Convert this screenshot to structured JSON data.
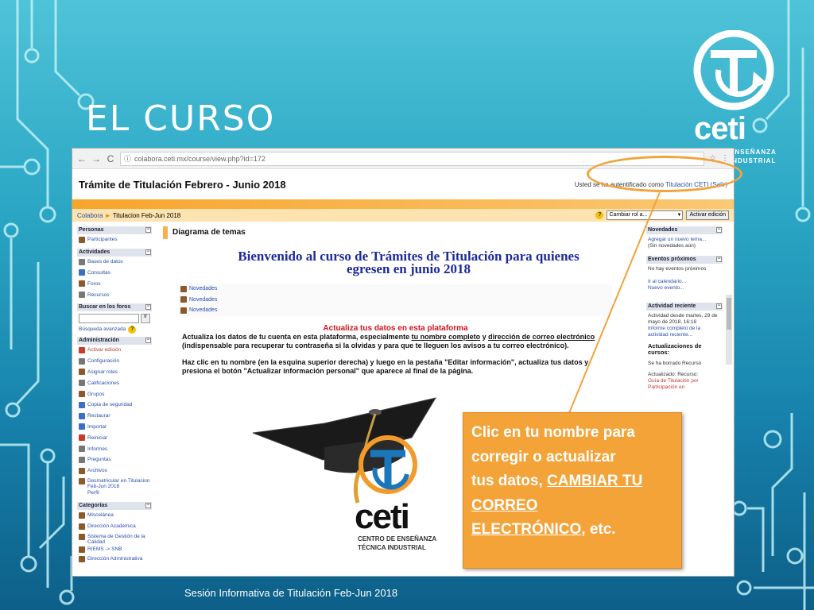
{
  "slide": {
    "title": "EL CURSO",
    "footer": "Sesión Informativa de Titulación Feb-Jun 2018",
    "logo": {
      "word": "ceti",
      "sub_line1": "ENSEÑANZA",
      "sub_line2": "INDUSTRIAL"
    }
  },
  "browser": {
    "url": "colabora.ceti.mx/course/view.php?id=172",
    "back_icon": "←",
    "forward_icon": "→",
    "reload_icon": "C",
    "info_icon": "ⓘ",
    "star_icon": "☆",
    "menu_icon": "⋮"
  },
  "page": {
    "course_title": "Trámite de Titulación Febrero - Junio 2018",
    "login_prefix": "Usted se ha autentificado como",
    "login_user": "Titulación CETI",
    "login_logout": "(Salir)",
    "breadcrumb_home": "Colabora",
    "breadcrumb_arrow": "►",
    "breadcrumb_course": "Titulacion Feb-Jun 2018",
    "help_label": "?",
    "role_select": "Cambiar rol a...",
    "edit_button": "Activar edición"
  },
  "left_blocks": {
    "personas": {
      "title": "Personas",
      "items": [
        "Participantes"
      ]
    },
    "actividades": {
      "title": "Actividades",
      "items": [
        "Bases de datos",
        "Consultas",
        "Foros",
        "Recursos"
      ]
    },
    "buscar": {
      "title": "Buscar en los foros",
      "button": "Ir",
      "advanced": "Búsqueda avanzada",
      "help": "?"
    },
    "administracion": {
      "title": "Administración",
      "items": [
        "Activar edición",
        "Configuración",
        "Asignar roles",
        "Calificaciones",
        "Grupos",
        "Copia de seguridad",
        "Restaurar",
        "Importar",
        "Reiniciar",
        "Informes",
        "Preguntas",
        "Archivos",
        "Desmatricular en Titulacion Feb-Jun 2018",
        "Perfil"
      ]
    },
    "categorias": {
      "title": "Categorías",
      "items": [
        "Miscelánea",
        "Dirección Académica",
        "Sistema de Gestión de la Calidad",
        "RIEMS -> SNB",
        "Dirección Administrativa"
      ]
    },
    "collapse_icon": "−"
  },
  "center": {
    "diagram_title": "Diagrama de temas",
    "welcome_line1": "Bienvenido al curso de Trámites de Titulación para quienes",
    "welcome_line2": "egresen en junio 2018",
    "news": [
      "Novedades",
      "Novedades",
      "Novedades"
    ],
    "update_title": "Actualiza tus datos en esta plataforma",
    "update_p1_a": "Actualiza los datos de tu cuenta en esta plataforma, especialmente ",
    "update_p1_u1": "tu nombre completo",
    "update_p1_b": " y ",
    "update_p1_u2": "dirección de correo electrónico",
    "update_p1_c": " (indispensable para recuperar tu contraseña si la olvidas y para que te lleguen los avisos a tu correo electrónico).",
    "update_p2": "Haz clic en tu nombre (en la esquina superior derecha) y luego en la pestaña \"Editar información\", actualiza tus datos y presiona el botón \"Actualizar información personal\" que aparece al final de la página.",
    "cap_logo_word": "ceti",
    "cap_logo_sub1": "CENTRO DE ENSEÑANZA",
    "cap_logo_sub2": "TÉCNICA INDUSTRIAL"
  },
  "right_blocks": {
    "novedades": {
      "title": "Novedades",
      "link": "Agregar un nuevo tema...",
      "note": "(Sin novedades aún)"
    },
    "eventos": {
      "title": "Eventos próximos",
      "none": "No hay eventos próximos",
      "cal_link": "Ir al calendario...",
      "new_link": "Nuevo evento..."
    },
    "actividad": {
      "title": "Actividad reciente",
      "since": "Actividad desde martes, 29 de mayo de 2018, 16:18",
      "full_link": "Informe completo de la actividad reciente...",
      "updates_title": "Actualizaciones de cursos:",
      "deleted": "Se ha borrado Recurso",
      "updated_label": "Actualizado: Recurso:",
      "updated_item": "Guía de Titulación por Participación en"
    }
  },
  "callout": {
    "line1": "Clic en tu nombre para",
    "line2": "corregir  o actualizar",
    "line3_a": "tus datos, ",
    "line3_u": "CAMBIAR TU",
    "line4_u": "CORREO",
    "line5_u": "ELECTRÓNICO",
    "line5_b": ", etc."
  },
  "colors": {
    "accent_orange": "#f4a339",
    "link_blue": "#2a4fa8",
    "welcome_blue": "#1c2a9c",
    "alert_red": "#d4141d"
  }
}
